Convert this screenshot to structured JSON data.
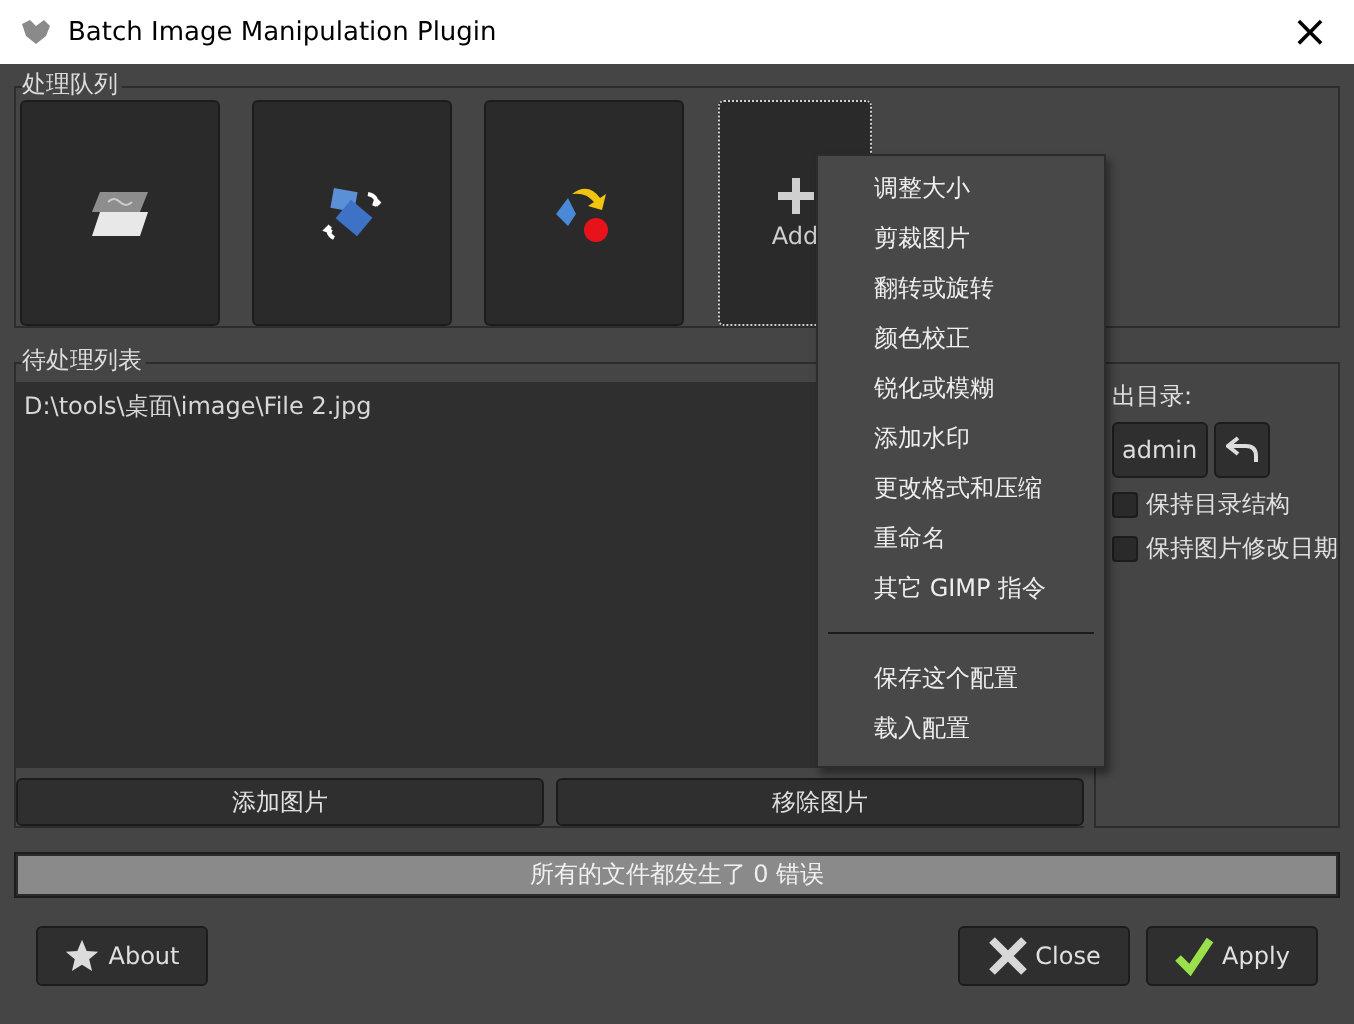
{
  "window": {
    "title": "Batch Image Manipulation Plugin",
    "close": "×"
  },
  "queue": {
    "label": "处理队列",
    "tiles": [
      {
        "kind": "layers"
      },
      {
        "kind": "rotate"
      },
      {
        "kind": "color"
      },
      {
        "kind": "add",
        "label": "Add",
        "focused": true
      }
    ]
  },
  "file_list": {
    "label": "待处理列表",
    "files": [
      "D:\\tools\\桌面\\image\\File 2.jpg"
    ],
    "buttons": [
      "添加图片",
      "移除图片"
    ]
  },
  "output": {
    "label": "出目录:",
    "folder": "admin",
    "options": [
      {
        "label": "保持目录结构",
        "checked": false
      },
      {
        "label": "保持图片修改日期",
        "checked": false
      }
    ]
  },
  "progress": {
    "text": "所有的文件都发生了 0 错误",
    "level": 1
  },
  "buttons": [
    {
      "kind": "about",
      "label": "About"
    },
    {
      "kind": "close",
      "label": "Close"
    },
    {
      "kind": "apply",
      "label": "Apply"
    }
  ],
  "menu": [
    {
      "kind": "item",
      "label": "调整大小"
    },
    {
      "kind": "item",
      "label": "剪裁图片"
    },
    {
      "kind": "item",
      "label": "翻转或旋转"
    },
    {
      "kind": "item",
      "label": "颜色校正"
    },
    {
      "kind": "item",
      "label": "锐化或模糊"
    },
    {
      "kind": "item",
      "label": "添加水印"
    },
    {
      "kind": "item",
      "label": "更改格式和压缩"
    },
    {
      "kind": "item",
      "label": "重命名"
    },
    {
      "kind": "item",
      "label": "其它 GIMP 指令"
    },
    {
      "kind": "separator"
    },
    {
      "kind": "item",
      "label": "保存这个配置"
    },
    {
      "kind": "item",
      "label": "载入配置"
    }
  ]
}
